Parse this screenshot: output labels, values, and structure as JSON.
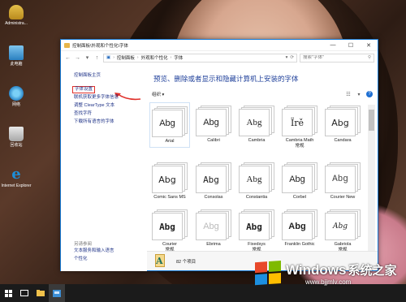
{
  "desktop": {
    "icons": [
      {
        "label": "Administra...",
        "icon": "user-folder-icon"
      },
      {
        "label": "此电脑",
        "icon": "computer-icon"
      },
      {
        "label": "网络",
        "icon": "network-icon"
      },
      {
        "label": "回收站",
        "icon": "recycle-bin-icon"
      },
      {
        "label": "Internet Explorer",
        "icon": "internet-explorer-icon"
      }
    ]
  },
  "window": {
    "title": "控制面板\\外观和个性化\\字体",
    "controls": {
      "minimize": "—",
      "maximize": "☐",
      "close": "✕"
    },
    "breadcrumb": [
      "控制面板",
      "外观和个性化",
      "字体"
    ],
    "search_placeholder": "搜索\"字体\""
  },
  "sidebar": {
    "home": "控制面板主页",
    "links": [
      "字体设置",
      "联机获取更多字体信息",
      "调整 ClearType 文本",
      "查找字符",
      "下载所有语言的字体"
    ],
    "see_also": "另请参阅",
    "see_also_links": [
      "文本服务和输入语言",
      "个性化"
    ]
  },
  "main": {
    "heading": "预览、删除或者显示和隐藏计算机上安装的字体",
    "organize": "组织 ▾",
    "fonts": [
      {
        "sample": "Abg",
        "name": "Arial",
        "selected": true
      },
      {
        "sample": "Abg",
        "name": "Calibri"
      },
      {
        "sample": "Abg",
        "name": "Cambria"
      },
      {
        "sample": "Ïrě",
        "name": "Cambria Math",
        "sub": "常规"
      },
      {
        "sample": "Abg",
        "name": "Candara"
      },
      {
        "sample": "Abg",
        "name": "Comic Sans MS"
      },
      {
        "sample": "Abg",
        "name": "Consolas"
      },
      {
        "sample": "Abg",
        "name": "Constantia"
      },
      {
        "sample": "Abg",
        "name": "Corbel"
      },
      {
        "sample": "Abg",
        "name": "Courier New"
      },
      {
        "sample": "Abg",
        "name": "Courier",
        "sub": "常规"
      },
      {
        "sample": "Abg",
        "name": "Ebrima"
      },
      {
        "sample": "Abg",
        "name": "Fixedsys",
        "sub": "常规"
      },
      {
        "sample": "Abg",
        "name": "Franklin Gothic"
      },
      {
        "sample": "Abg",
        "name": "Gabriola",
        "sub": "常规"
      }
    ],
    "status_count": "82 个项目"
  },
  "watermark": {
    "brand": "Windows",
    "cn": "系统之家",
    "url": "www.bjjmlv.com"
  },
  "colors": {
    "accent": "#1778d1",
    "link": "#1e3287",
    "heading": "#1e3f9a",
    "highlight_box": "#e0302a"
  }
}
